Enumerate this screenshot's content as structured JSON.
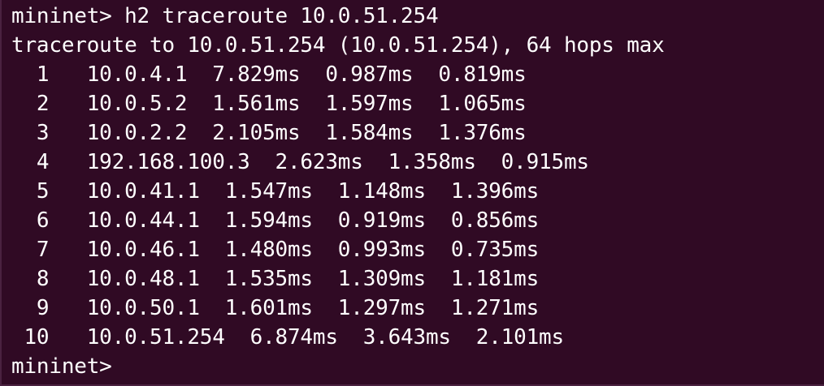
{
  "terminal": {
    "background_color": "#300a24",
    "text_color": "#ffffff",
    "command_line": "mininet> h2 traceroute 10.0.51.254",
    "header_line": "traceroute to 10.0.51.254 (10.0.51.254), 64 hops max",
    "hops": [
      "  1   10.0.4.1  7.829ms  0.987ms  0.819ms",
      "  2   10.0.5.2  1.561ms  1.597ms  1.065ms",
      "  3   10.0.2.2  2.105ms  1.584ms  1.376ms",
      "  4   192.168.100.3  2.623ms  1.358ms  0.915ms",
      "  5   10.0.41.1  1.547ms  1.148ms  1.396ms",
      "  6   10.0.44.1  1.594ms  0.919ms  0.856ms",
      "  7   10.0.46.1  1.480ms  0.993ms  0.735ms",
      "  8   10.0.48.1  1.535ms  1.309ms  1.181ms",
      "  9   10.0.50.1  1.601ms  1.297ms  1.271ms",
      " 10   10.0.51.254  6.874ms  3.643ms  2.101ms"
    ],
    "prompt": "mininet>"
  }
}
